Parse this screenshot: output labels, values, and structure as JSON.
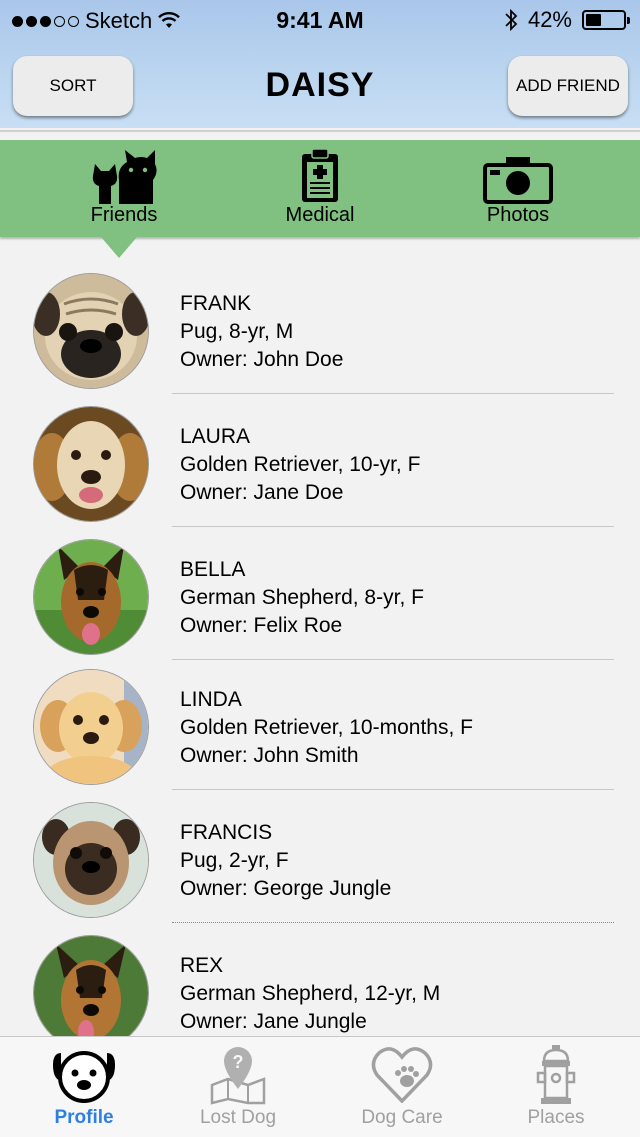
{
  "status_bar": {
    "carrier": "Sketch",
    "time": "9:41 AM",
    "battery": "42%",
    "battery_level": 0.42
  },
  "nav": {
    "title": "DAISY",
    "sort_label": "SORT",
    "add_friend_label": "ADD FRIEND"
  },
  "segments": [
    {
      "label": "Friends",
      "icon": "friends-icon",
      "selected": true
    },
    {
      "label": "Medical",
      "icon": "clipboard-icon",
      "selected": false
    },
    {
      "label": "Photos",
      "icon": "camera-icon",
      "selected": false
    }
  ],
  "friends": [
    {
      "name": "FRANK",
      "details": "Pug, 8-yr, M",
      "owner": "Owner: John Doe"
    },
    {
      "name": "LAURA",
      "details": "Golden Retriever, 10-yr, F",
      "owner": "Owner: Jane Doe"
    },
    {
      "name": "BELLA",
      "details": "German Shepherd, 8-yr, F",
      "owner": "Owner: Felix Roe"
    },
    {
      "name": "LINDA",
      "details": "Golden Retriever, 10-months, F",
      "owner": "Owner: John Smith"
    },
    {
      "name": "FRANCIS",
      "details": "Pug, 2-yr, F",
      "owner": "Owner: George Jungle"
    },
    {
      "name": "REX",
      "details": "German Shepherd, 12-yr, M",
      "owner": "Owner: Jane Jungle"
    }
  ],
  "tabs": [
    {
      "label": "Profile",
      "icon": "dog-face-icon",
      "active": true
    },
    {
      "label": "Lost Dog",
      "icon": "map-question-icon",
      "active": false
    },
    {
      "label": "Dog Care",
      "icon": "heart-paw-icon",
      "active": false
    },
    {
      "label": "Places",
      "icon": "fire-hydrant-icon",
      "active": false
    }
  ],
  "colors": {
    "header": "#bcd6f0",
    "segment_bar": "#80c080",
    "active_tab": "#2f7fe0",
    "inactive_tab": "#a0a0a0"
  }
}
